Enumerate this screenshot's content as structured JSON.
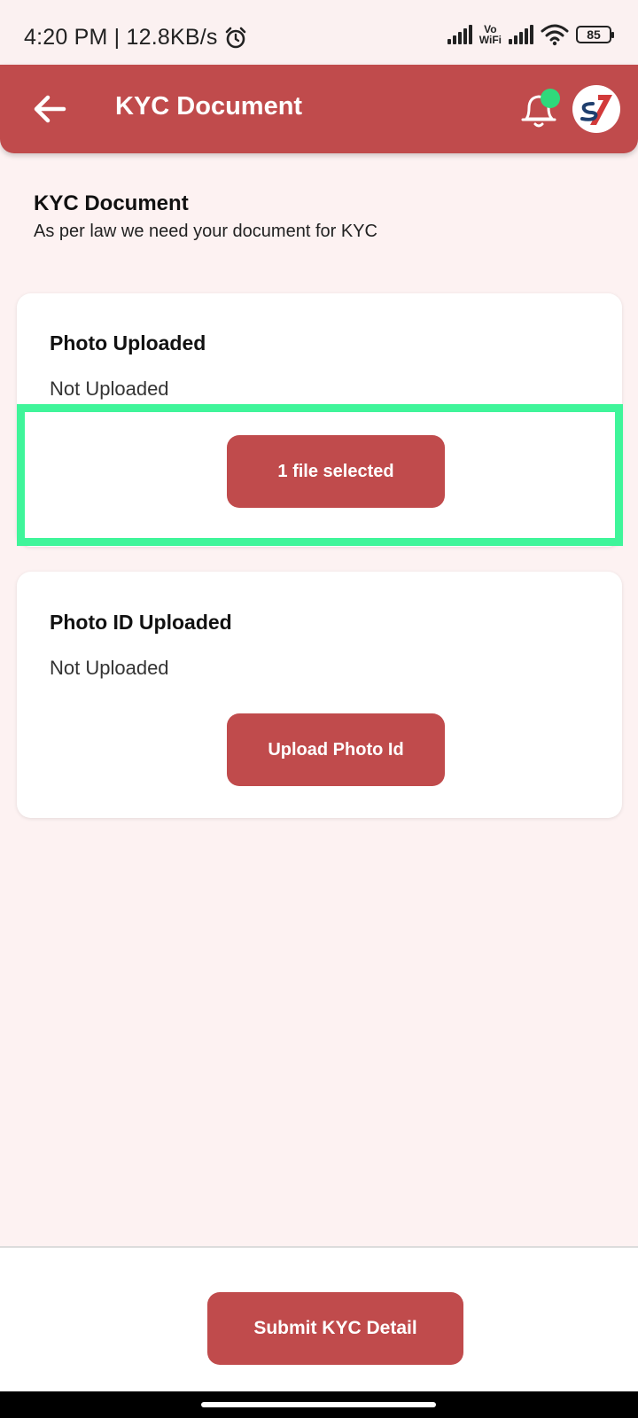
{
  "status_bar": {
    "time_speed": "4:20 PM | 12.8KB/s",
    "vowifi_top": "Vo",
    "vowifi_bottom": "WiFi",
    "battery": "85"
  },
  "header": {
    "title": "KYC Document",
    "accent_color": "#c04b4c",
    "notification_dot_color": "#2fd97b"
  },
  "intro": {
    "title": "KYC Document",
    "subtitle": "As per law we need your document for KYC"
  },
  "cards": [
    {
      "title": "Photo Uploaded",
      "status": "Not Uploaded",
      "button_label": "1 file selected"
    },
    {
      "title": "Photo ID Uploaded",
      "status": "Not Uploaded",
      "button_label": "Upload Photo Id"
    }
  ],
  "footer": {
    "submit_label": "Submit KYC Detail"
  },
  "highlight_color": "#3ff59a"
}
